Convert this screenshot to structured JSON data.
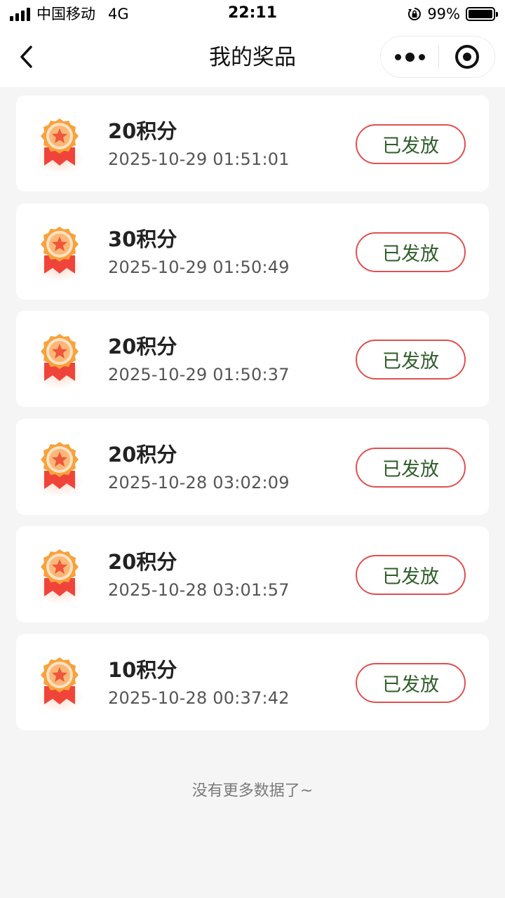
{
  "status_bar": {
    "carrier": "中国移动",
    "network": "4G",
    "time": "22:11",
    "battery_percent": "99%",
    "icons": [
      "signal-icon",
      "rotation-lock-icon",
      "battery-icon"
    ]
  },
  "nav": {
    "title": "我的奖品",
    "icons": [
      "back-chevron-icon",
      "more-dots-icon",
      "close-target-icon"
    ]
  },
  "prizes": [
    {
      "points": "20积分",
      "time": "2025-10-29 01:51:01",
      "status": "已发放"
    },
    {
      "points": "30积分",
      "time": "2025-10-29 01:50:49",
      "status": "已发放"
    },
    {
      "points": "20积分",
      "time": "2025-10-29 01:50:37",
      "status": "已发放"
    },
    {
      "points": "20积分",
      "time": "2025-10-28 03:02:09",
      "status": "已发放"
    },
    {
      "points": "20积分",
      "time": "2025-10-28 03:01:57",
      "status": "已发放"
    },
    {
      "points": "10积分",
      "time": "2025-10-28 00:37:42",
      "status": "已发放"
    }
  ],
  "footer": {
    "no_more": "没有更多数据了~"
  },
  "colors": {
    "page_bg": "#f5f5f5",
    "card_bg": "#ffffff",
    "status_border": "#e05050",
    "status_text": "#2f5e2a",
    "medal_orange": "#f7a23b",
    "ribbon_red": "#f0443a"
  }
}
